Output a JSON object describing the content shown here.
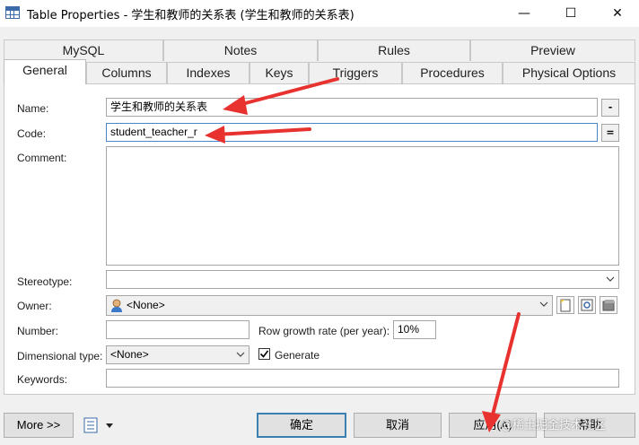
{
  "window": {
    "title": "Table Properties - 学生和教师的关系表 (学生和教师的关系表)",
    "minimize": "—",
    "maximize": "☐",
    "close": "✕"
  },
  "tabs_back": [
    "MySQL",
    "Notes",
    "Rules",
    "Preview"
  ],
  "tabs_front": [
    "General",
    "Columns",
    "Indexes",
    "Keys",
    "Triggers",
    "Procedures",
    "Physical Options"
  ],
  "active_tab": "General",
  "form": {
    "name_label": "Name:",
    "name_value": "学生和教师的关系表",
    "code_label": "Code:",
    "code_value": "student_teacher_r",
    "comment_label": "Comment:",
    "comment_value": "",
    "stereotype_label": "Stereotype:",
    "stereotype_value": "",
    "owner_label": "Owner:",
    "owner_value": "<None>",
    "number_label": "Number:",
    "number_value": "",
    "row_growth_label": "Row growth rate (per year):",
    "row_growth_value": "10%",
    "dimensional_label": "Dimensional type:",
    "dimensional_value": "<None>",
    "generate_label": "Generate",
    "generate_checked": true,
    "keywords_label": "Keywords:",
    "keywords_value": "",
    "ellipsis_btn": "-",
    "equals_btn": "="
  },
  "footer": {
    "more_label": "More >>",
    "ok_label": "确定",
    "cancel_label": "取消",
    "apply_label": "应用(A)",
    "help_label": "帮助"
  },
  "watermark": "@稀土掘金技术社区",
  "colors": {
    "arrow": "#e8322f",
    "focus_border": "#4a86c8",
    "default_button_border": "#3c7fb1"
  }
}
